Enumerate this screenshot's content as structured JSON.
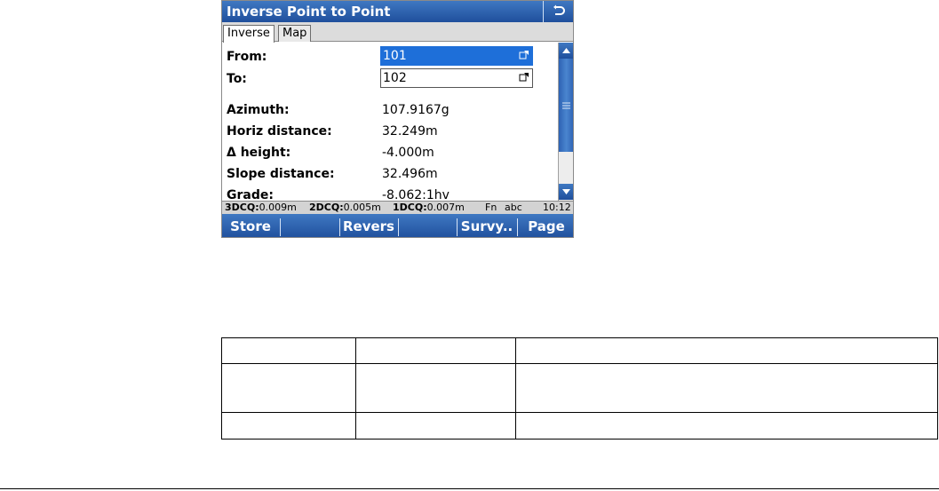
{
  "window": {
    "title": "Inverse Point to Point"
  },
  "tabs": [
    {
      "label": "Inverse"
    },
    {
      "label": "Map"
    }
  ],
  "fields": {
    "from": {
      "label": "From:",
      "value": "101"
    },
    "to": {
      "label": "To:",
      "value": "102"
    }
  },
  "results": [
    {
      "label": "Azimuth:",
      "value": "107.9167g"
    },
    {
      "label": "Horiz distance:",
      "value": "32.249m"
    },
    {
      "label": "Δ height:",
      "value": "-4.000m"
    },
    {
      "label": "Slope distance:",
      "value": "32.496m"
    },
    {
      "label": "Grade:",
      "value": "-8.062:1hv"
    }
  ],
  "status": {
    "dcq3_label": "3DCQ:",
    "dcq3_value": "0.009m",
    "dcq2_label": "2DCQ:",
    "dcq2_value": "0.005m",
    "dcq1_label": "1DCQ:",
    "dcq1_value": "0.007m",
    "fn": "Fn",
    "input_mode": "abc",
    "time": "10:12"
  },
  "softkeys": {
    "store": "Store",
    "revers": "Revers",
    "survy": "Survy..",
    "page": "Page"
  },
  "icons": {
    "back": "return-arrow-icon",
    "picker": "list-picker-icon",
    "scroll_up": "scroll-up-icon",
    "scroll_down": "scroll-down-icon"
  },
  "colors": {
    "title_bar": "#2d62b3",
    "selection": "#1e6fd9",
    "status_bar": "#d3d3d3"
  }
}
